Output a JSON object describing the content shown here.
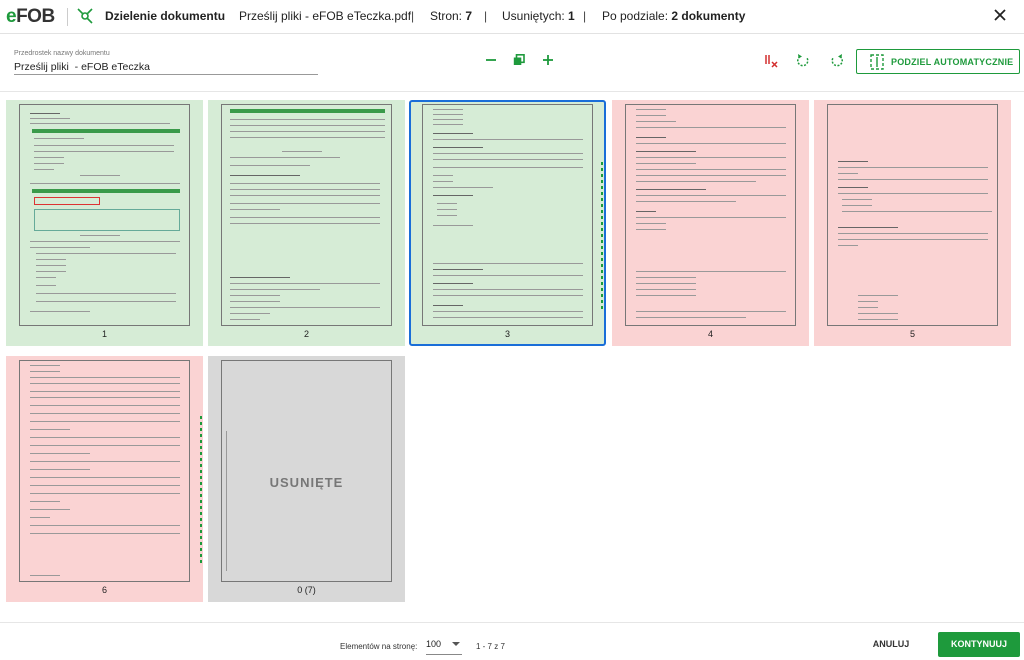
{
  "header": {
    "logo_e": "e",
    "logo_fob": "FOB",
    "title": "Dzielenie dokumentu",
    "file_name": "Prześlij pliki  - eFOB eTeczka.pdf",
    "pages_label": "Stron:",
    "pages_value": "7",
    "deleted_label": "Usuniętych:",
    "deleted_value": "1",
    "after_split_label": "Po podziale:",
    "after_split_value": "2 dokumenty",
    "separator": "|",
    "close_icon": "close-icon"
  },
  "toolbar": {
    "name_label": "Przedrostek nazwy dokumentu",
    "name_value": "Prześlij pliki  - eFOB eTeczka",
    "zoom_out_icon": "minus-icon",
    "fit_icon": "copy-icon",
    "zoom_in_icon": "plus-icon",
    "clear_split_icon": "clear-split-icon",
    "rotate_left_icon": "rotate-left-icon",
    "rotate_right_icon": "rotate-right-icon",
    "auto_split_label": "PODZIEL AUTOMATYCZNIE"
  },
  "pages": [
    {
      "label": "1",
      "state": "green"
    },
    {
      "label": "2",
      "state": "green"
    },
    {
      "label": "3",
      "state": "green",
      "selected": true
    },
    {
      "label": "4",
      "state": "red"
    },
    {
      "label": "5",
      "state": "red"
    },
    {
      "label": "6",
      "state": "red"
    },
    {
      "label": "0 (7)",
      "state": "deleted",
      "deleted_text": "USUNIĘTE"
    }
  ],
  "footer": {
    "per_page_label": "Elementów na stronę:",
    "per_page_value": "100",
    "range": "1 - 7 z 7",
    "cancel_label": "ANULUJ",
    "continue_label": "KONTYNUUJ"
  },
  "colors": {
    "accent": "#1e9a3c",
    "doc1_bg": "#d6ecd6",
    "doc2_bg": "#fad3d3",
    "deleted_bg": "#d8d8d8",
    "danger": "#d32f2f",
    "selection": "#1a6ed8"
  }
}
